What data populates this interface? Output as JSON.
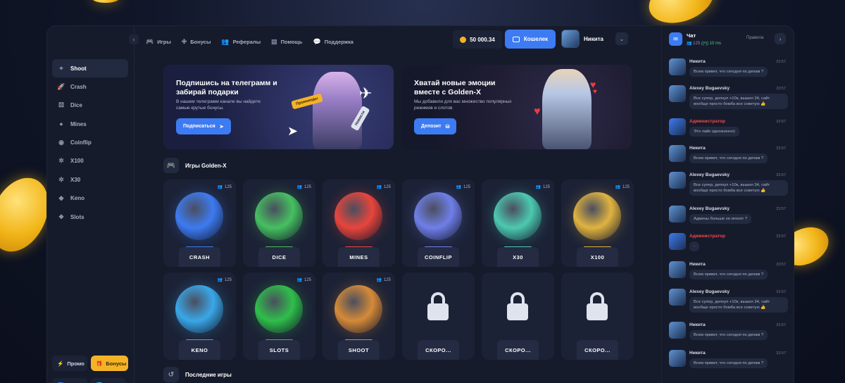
{
  "sidebar": {
    "items": [
      {
        "label": "Shoot",
        "icon": "crosshair-icon",
        "active": true
      },
      {
        "label": "Crash",
        "icon": "rocket-icon"
      },
      {
        "label": "Dice",
        "icon": "dice-icon"
      },
      {
        "label": "Mines",
        "icon": "bomb-icon"
      },
      {
        "label": "Coinflip",
        "icon": "coin-icon"
      },
      {
        "label": "X100",
        "icon": "wheel-icon"
      },
      {
        "label": "X30",
        "icon": "wheel-icon"
      },
      {
        "label": "Keno",
        "icon": "keno-icon"
      },
      {
        "label": "Slots",
        "icon": "slots-icon"
      }
    ],
    "promo_label": "Промо",
    "bonus_label": "Бонусы",
    "vk_label": "VK",
    "tg_label": "TG"
  },
  "header": {
    "tabs": [
      {
        "label": "Игры",
        "icon": "gamepad-icon"
      },
      {
        "label": "Бонусы",
        "icon": "gift-icon"
      },
      {
        "label": "Рефералы",
        "icon": "users-icon"
      },
      {
        "label": "Помощь",
        "icon": "help-icon"
      },
      {
        "label": "Поддержка",
        "icon": "chat-icon"
      }
    ],
    "balance": "50 000.34",
    "wallet_label": "Кошелек",
    "username": "Никита"
  },
  "banners": [
    {
      "title": "Подпишись на телеграмм и забирай подарки",
      "subtitle": "В нашем телеграмм канале вы найдете самые крутые бонусы.",
      "button": "Подписаться",
      "tag1": "Промокоды",
      "tag2": "Новости"
    },
    {
      "title": "Хватай новые эмоции вместе с Golden-X",
      "subtitle": "Мы добавили для вас множество популярных режимов и слотов",
      "button": "Депозит"
    }
  ],
  "games_section": {
    "title": "Игры Golden-X"
  },
  "games": [
    {
      "name": "CRASH",
      "online": "125",
      "color": "#3d7bf2"
    },
    {
      "name": "DICE",
      "online": "125",
      "color": "#46c060"
    },
    {
      "name": "MINES",
      "online": "125",
      "color": "#e8453c"
    },
    {
      "name": "COINFLIP",
      "online": "125",
      "color": "#6f7fe8"
    },
    {
      "name": "X30",
      "online": "125",
      "color": "#4cc9b0"
    },
    {
      "name": "X100",
      "online": "125",
      "color": "#e0b340"
    },
    {
      "name": "KENO",
      "online": "125",
      "color": "#3aa7e8"
    },
    {
      "name": "SLOTS",
      "online": "125",
      "color": "#2fbf4a"
    },
    {
      "name": "SHOOT",
      "online": "125",
      "color": "#d68a38"
    },
    {
      "name": "СКОРО...",
      "online": ""
    },
    {
      "name": "СКОРО...",
      "online": ""
    },
    {
      "name": "СКОРО...",
      "online": ""
    }
  ],
  "recent_section": {
    "title": "Последние игры"
  },
  "chat": {
    "title": "Чат",
    "online": "125",
    "ping": "10 ms",
    "rules": "Правила",
    "messages": [
      {
        "name": "Никита",
        "time": "23:57",
        "text": "Всем привет, что сегодня по депам ?"
      },
      {
        "name": "Alexey Bugaevsky",
        "time": "23:57",
        "text": "Все супер, депнул +10к, вышел 34, сайт вообще просто бомба все советую 👍"
      },
      {
        "name": "Администратор",
        "time": "23:57",
        "text": "Это лайк однозначно)",
        "admin": true
      },
      {
        "name": "Никита",
        "time": "23:57",
        "text": "Всем привет, что сегодня по депам ?"
      },
      {
        "name": "Alexey Bugaevsky",
        "time": "23:57",
        "text": "Все супер, депнул +10к, вышел 34, сайт вообще просто бомба все советую 👍"
      },
      {
        "name": "Alexey Bugaevsky",
        "time": "23:57",
        "text": "Админы больше не игонят ?"
      },
      {
        "name": "Администратор",
        "time": "23:57",
        "text": "-",
        "admin": true
      },
      {
        "name": "Никита",
        "time": "23:57",
        "text": "Всем привет, что сегодня по депам ?"
      },
      {
        "name": "Alexey Bugaevsky",
        "time": "23:57",
        "text": "Все супер, депнул +10к, вышел 34, сайт вообще просто бомба все советую 👍"
      },
      {
        "name": "Никита",
        "time": "23:57",
        "text": "Всем привет, что сегодня по депам ?"
      },
      {
        "name": "Никита",
        "time": "23:57",
        "text": "Всем привет, что сегодня по депам ?"
      }
    ]
  }
}
